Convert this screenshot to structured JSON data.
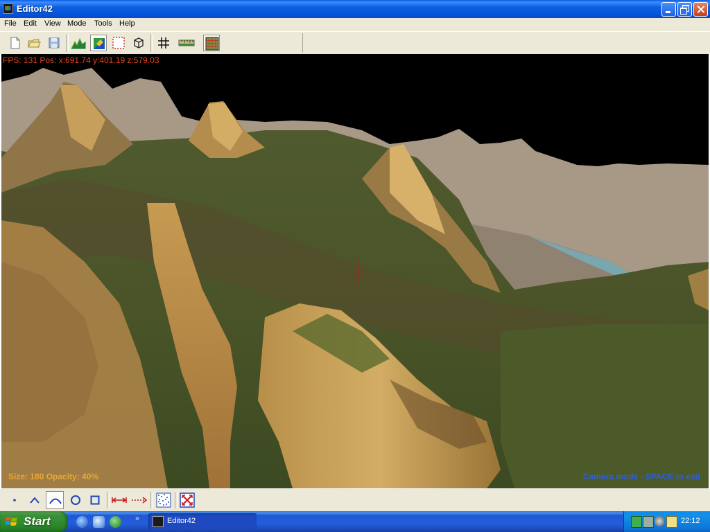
{
  "window": {
    "title": "Editor42"
  },
  "menu": [
    "File",
    "Edit",
    "View",
    "Mode",
    "Tools",
    "Help"
  ],
  "toolbar": {
    "icons": [
      "new-file-icon",
      "open-folder-icon",
      "save-icon",
      "heightmap-icon",
      "texture-paint-icon",
      "selection-icon",
      "cube-icon",
      "grid-icon",
      "ruler-icon",
      "tile-grid-icon"
    ],
    "pressed": "texture-paint-icon"
  },
  "viewport": {
    "fps_text": "FPS: 131   Pos: x:691.74  y:401.19  z:579.03",
    "brush_text": "Size: 180   Opacity: 40%",
    "mode_text": "Camera mode - SPACE to exit"
  },
  "bottom_tools": {
    "icons": [
      "point-brush-icon",
      "peak-brush-icon",
      "smooth-brush-icon",
      "circle-brush-icon",
      "square-brush-icon",
      "line-segment-icon",
      "arrow-line-icon",
      "noise-icon",
      "fit-view-icon"
    ],
    "pressed": "smooth-brush-icon"
  },
  "taskbar": {
    "start_label": "Start",
    "task_label": "Editor42",
    "clock": "22:12"
  },
  "colors": {
    "hud_red": "#e0471e",
    "hud_orange": "#e8a83a",
    "hud_blue": "#2e5fd6"
  }
}
